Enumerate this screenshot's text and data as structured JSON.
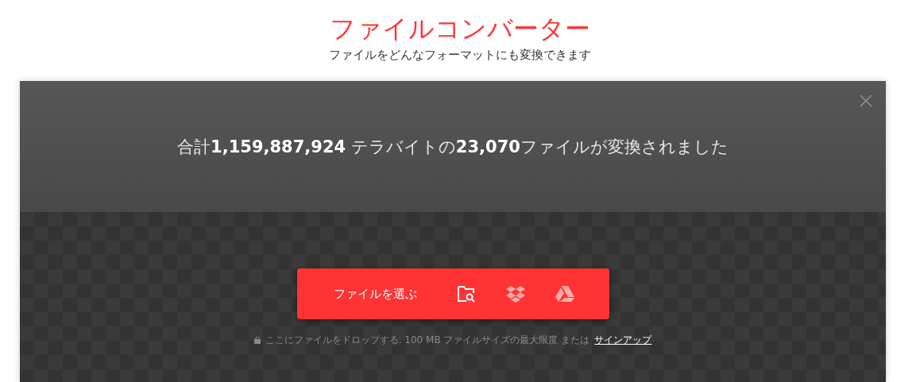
{
  "header": {
    "title": "ファイルコンバーター",
    "subtitle": "ファイルをどんなフォーマットにも変換できます"
  },
  "panel": {
    "stats": "合計**1,159,887,924** テラバイトの**23,070**ファイルが変換されました",
    "upload_button": {
      "label": "ファイルを選ぶ"
    },
    "note": "ここにファイルをドロップする. 100 MB ファイルサイズの最大限度 または",
    "signup_link": "サインアップ"
  }
}
